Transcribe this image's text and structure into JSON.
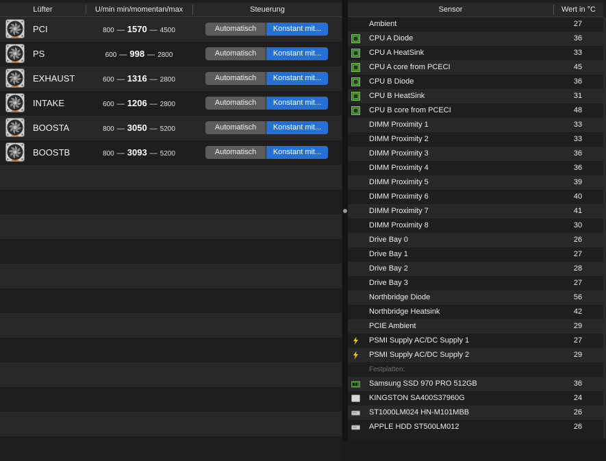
{
  "fans": {
    "columns": {
      "name": "Lüfter",
      "rpm": "U/min min/momentan/max",
      "control": "Steuerung"
    },
    "rows": [
      {
        "name": "PCI",
        "min": "800",
        "current": "1570",
        "max": "4500",
        "auto_label": "Automatisch",
        "const_label": "Konstant mit..."
      },
      {
        "name": "PS",
        "min": "600",
        "current": "998",
        "max": "2800",
        "auto_label": "Automatisch",
        "const_label": "Konstant mit..."
      },
      {
        "name": "EXHAUST",
        "min": "600",
        "current": "1316",
        "max": "2800",
        "auto_label": "Automatisch",
        "const_label": "Konstant mit..."
      },
      {
        "name": "INTAKE",
        "min": "600",
        "current": "1206",
        "max": "2800",
        "auto_label": "Automatisch",
        "const_label": "Konstant mit..."
      },
      {
        "name": "BOOSTA",
        "min": "800",
        "current": "3050",
        "max": "5200",
        "auto_label": "Automatisch",
        "const_label": "Konstant mit..."
      },
      {
        "name": "BOOSTB",
        "min": "800",
        "current": "3093",
        "max": "5200",
        "auto_label": "Automatisch",
        "const_label": "Konstant mit..."
      }
    ]
  },
  "sensors": {
    "columns": {
      "sensor": "Sensor",
      "value": "Wert in °C"
    },
    "rows": [
      {
        "name": "Ambient",
        "value": "27",
        "icon": ""
      },
      {
        "name": "CPU A Diode",
        "value": "36",
        "icon": "chip-icon"
      },
      {
        "name": "CPU A HeatSink",
        "value": "33",
        "icon": "chip-icon"
      },
      {
        "name": "CPU A core from PCECI",
        "value": "45",
        "icon": "chip-icon"
      },
      {
        "name": "CPU B Diode",
        "value": "36",
        "icon": "chip-icon"
      },
      {
        "name": "CPU B HeatSink",
        "value": "31",
        "icon": "chip-icon"
      },
      {
        "name": "CPU B core from PCECI",
        "value": "48",
        "icon": "chip-icon"
      },
      {
        "name": "DIMM Proximity 1",
        "value": "33",
        "icon": ""
      },
      {
        "name": "DIMM Proximity 2",
        "value": "33",
        "icon": ""
      },
      {
        "name": "DIMM Proximity 3",
        "value": "36",
        "icon": ""
      },
      {
        "name": "DIMM Proximity 4",
        "value": "36",
        "icon": ""
      },
      {
        "name": "DIMM Proximity 5",
        "value": "39",
        "icon": ""
      },
      {
        "name": "DIMM Proximity 6",
        "value": "40",
        "icon": ""
      },
      {
        "name": "DIMM Proximity 7",
        "value": "41",
        "icon": ""
      },
      {
        "name": "DIMM Proximity 8",
        "value": "30",
        "icon": ""
      },
      {
        "name": "Drive Bay 0",
        "value": "26",
        "icon": ""
      },
      {
        "name": "Drive Bay 1",
        "value": "27",
        "icon": ""
      },
      {
        "name": "Drive Bay 2",
        "value": "28",
        "icon": ""
      },
      {
        "name": "Drive Bay 3",
        "value": "27",
        "icon": ""
      },
      {
        "name": "Northbridge Diode",
        "value": "56",
        "icon": ""
      },
      {
        "name": "Northbridge Heatsink",
        "value": "42",
        "icon": ""
      },
      {
        "name": "PCIE Ambient",
        "value": "29",
        "icon": ""
      },
      {
        "name": "PSMI Supply AC/DC Supply 1",
        "value": "27",
        "icon": "lightning-icon"
      },
      {
        "name": "PSMI Supply AC/DC Supply 2",
        "value": "29",
        "icon": "lightning-icon"
      },
      {
        "name": "Festplatten:",
        "value": "",
        "icon": "",
        "group": true
      },
      {
        "name": "Samsung SSD 970 PRO 512GB",
        "value": "36",
        "icon": "ssd-card-icon"
      },
      {
        "name": "KINGSTON SA400S37960G",
        "value": "24",
        "icon": "ssd-drive-icon"
      },
      {
        "name": "ST1000LM024 HN-M101MBB",
        "value": "26",
        "icon": "hdd-icon"
      },
      {
        "name": "APPLE HDD ST500LM012",
        "value": "26",
        "icon": "hdd-icon"
      }
    ]
  },
  "colors": {
    "accent": "#2470d6",
    "button_gray": "#5c5c5c",
    "chip_green": "#3f9a2f",
    "lightning": "#f2c400"
  }
}
